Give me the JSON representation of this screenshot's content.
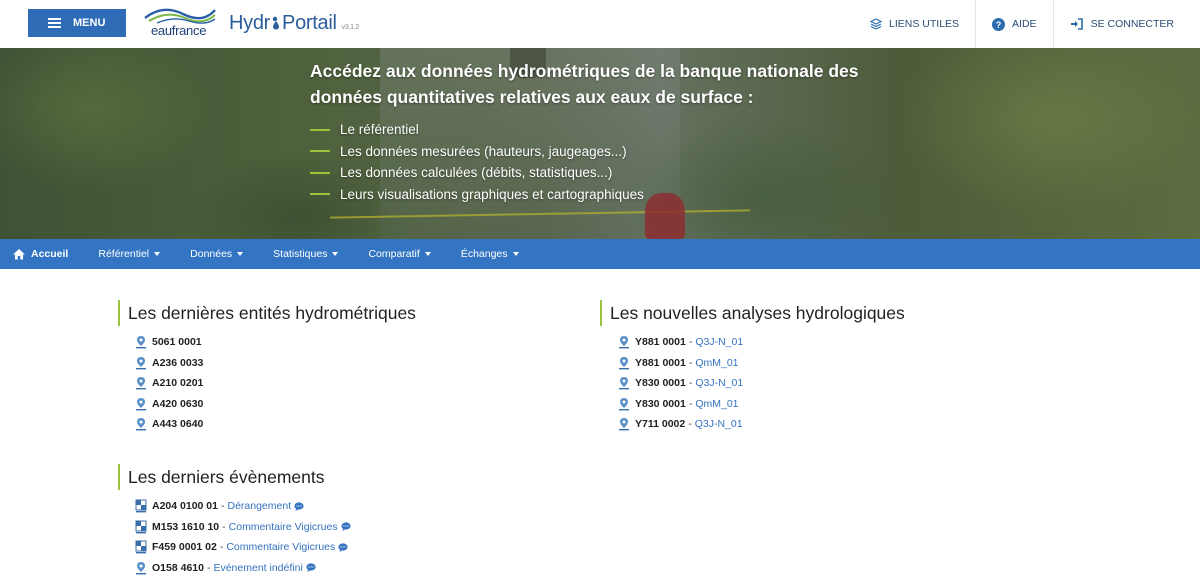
{
  "header": {
    "menu_label": "MENU",
    "logo_eaufrance": "eaufrance",
    "logo_hydro_left": "Hydr",
    "logo_hydro_right": "Portail",
    "version": "v3.1.2",
    "links": [
      {
        "label": "LIENS UTILES",
        "icon": "layers-icon"
      },
      {
        "label": "AIDE",
        "icon": "help-circle-icon"
      },
      {
        "label": "SE CONNECTER",
        "icon": "sign-in-icon"
      }
    ]
  },
  "hero": {
    "title": "Accédez aux données hydrométriques de la banque nationale des données quantitatives relatives aux eaux de surface :",
    "items": [
      "Le référentiel",
      "Les données mesurées (hauteurs, jaugeages...)",
      "Les données calculées (débits, statistiques...)",
      "Leurs visualisations graphiques et cartographiques"
    ]
  },
  "nav": {
    "home": "Accueil",
    "items": [
      "Référentiel",
      "Données",
      "Statistiques",
      "Comparatif",
      "Échanges"
    ]
  },
  "entities": {
    "title": "Les dernières entités hydrométriques",
    "items": [
      "5061 0001",
      "A236 0033",
      "A210 0201",
      "A420 0630",
      "A443 0640"
    ]
  },
  "analyses": {
    "title": "Les nouvelles analyses hydrologiques",
    "items": [
      {
        "code": "Y881 0001",
        "link": "Q3J-N_01"
      },
      {
        "code": "Y881 0001",
        "link": "QmM_01"
      },
      {
        "code": "Y830 0001",
        "link": "Q3J-N_01"
      },
      {
        "code": "Y830 0001",
        "link": "QmM_01"
      },
      {
        "code": "Y711 0002",
        "link": "Q3J-N_01"
      }
    ]
  },
  "events": {
    "title": "Les derniers évènements",
    "items": [
      {
        "code": "A204 0100 01",
        "link": "Dérangement",
        "icon": "station-grid-icon"
      },
      {
        "code": "M153 1610 10",
        "link": "Commentaire Vigicrues",
        "icon": "station-grid-icon"
      },
      {
        "code": "F459 0001 02",
        "link": "Commentaire Vigicrues",
        "icon": "station-grid-icon"
      },
      {
        "code": "O158 4610",
        "link": "Evénement indéfini",
        "icon": "map-pin-icon"
      }
    ]
  },
  "colors": {
    "primary": "#3375c3",
    "menu_button": "#2e6cb7",
    "accent_green": "#9bc43b",
    "link": "#3572c0"
  }
}
